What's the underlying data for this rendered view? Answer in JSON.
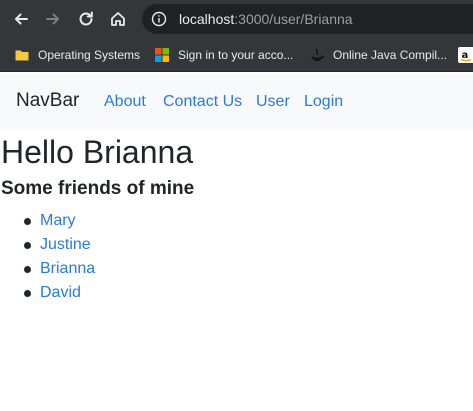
{
  "browser": {
    "url_host": "localhost",
    "url_path": ":3000/user/Brianna",
    "bookmarks": [
      {
        "label": "Operating Systems",
        "icon": "folder-icon"
      },
      {
        "label": "Sign in to your acco...",
        "icon": "microsoft-logo-icon"
      },
      {
        "label": "Online Java Compil...",
        "icon": "java-icon"
      },
      {
        "label": "",
        "icon": "amazon-icon"
      }
    ]
  },
  "navbar": {
    "brand": "NavBar",
    "links": [
      "About",
      "Contact Us",
      "User",
      "Login"
    ]
  },
  "main": {
    "heading": "Hello Brianna",
    "subheading": "Some friends of mine",
    "friends": [
      "Mary",
      "Justine",
      "Brianna",
      "David"
    ]
  },
  "colors": {
    "chrome_bg": "#35363a",
    "omnibox_bg": "#202124",
    "navbar_bg": "#f8f9fa",
    "link": "#2a7bd8",
    "text": "#212529"
  }
}
